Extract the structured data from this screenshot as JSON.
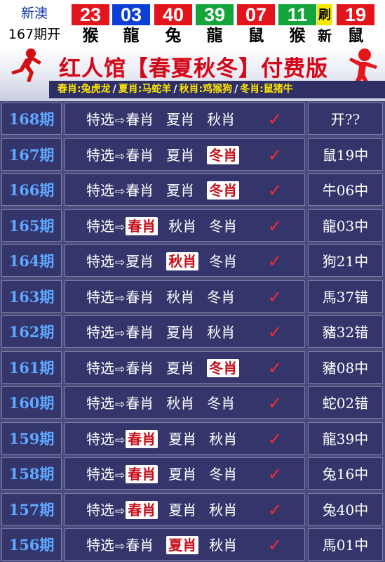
{
  "draw": {
    "label_line1": "新澳",
    "label_line2": "167期开",
    "balls": [
      {
        "num": "23",
        "zodiac": "猴",
        "color": "#e3141b"
      },
      {
        "num": "03",
        "zodiac": "龍",
        "color": "#0c3fd6"
      },
      {
        "num": "40",
        "zodiac": "兔",
        "color": "#e3141b"
      },
      {
        "num": "39",
        "zodiac": "龍",
        "color": "#14a53a"
      },
      {
        "num": "07",
        "zodiac": "鼠",
        "color": "#e3141b"
      },
      {
        "num": "11",
        "zodiac": "猴",
        "color": "#14a53a"
      },
      {
        "num": "刷",
        "zodiac": "新",
        "color": "#f6e800"
      },
      {
        "num": "19",
        "zodiac": "鼠",
        "color": "#e3141b"
      }
    ]
  },
  "banner": {
    "title": "红人馆【春夏秋冬】付费版",
    "seasons": [
      {
        "name": "春肖",
        "animals": "兔虎龙"
      },
      {
        "name": "夏肖",
        "animals": "马蛇羊"
      },
      {
        "name": "秋肖",
        "animals": "鸡猴狗"
      },
      {
        "name": "冬肖",
        "animals": "鼠猪牛"
      }
    ]
  },
  "table": {
    "prefix": "特选",
    "arrow": "⇨",
    "check": "✓",
    "rows": [
      {
        "period": "168期",
        "picks": [
          "春肖",
          "夏肖",
          "秋肖"
        ],
        "hit": -1,
        "result": "开??"
      },
      {
        "period": "167期",
        "picks": [
          "春肖",
          "夏肖",
          "冬肖"
        ],
        "hit": 2,
        "result": "鼠19中"
      },
      {
        "period": "166期",
        "picks": [
          "春肖",
          "夏肖",
          "冬肖"
        ],
        "hit": 2,
        "result": "牛06中"
      },
      {
        "period": "165期",
        "picks": [
          "春肖",
          "秋肖",
          "冬肖"
        ],
        "hit": 0,
        "result": "龍03中"
      },
      {
        "period": "164期",
        "picks": [
          "夏肖",
          "秋肖",
          "冬肖"
        ],
        "hit": 1,
        "result": "狗21中"
      },
      {
        "period": "163期",
        "picks": [
          "春肖",
          "秋肖",
          "冬肖"
        ],
        "hit": -1,
        "result": "馬37错"
      },
      {
        "period": "162期",
        "picks": [
          "春肖",
          "夏肖",
          "秋肖"
        ],
        "hit": -1,
        "result": "豬32错"
      },
      {
        "period": "161期",
        "picks": [
          "春肖",
          "夏肖",
          "冬肖"
        ],
        "hit": 2,
        "result": "豬08中"
      },
      {
        "period": "160期",
        "picks": [
          "春肖",
          "秋肖",
          "冬肖"
        ],
        "hit": -1,
        "result": "蛇02错"
      },
      {
        "period": "159期",
        "picks": [
          "春肖",
          "夏肖",
          "秋肖"
        ],
        "hit": 0,
        "result": "龍39中"
      },
      {
        "period": "158期",
        "picks": [
          "春肖",
          "夏肖",
          "冬肖"
        ],
        "hit": 0,
        "result": "兔16中"
      },
      {
        "period": "157期",
        "picks": [
          "春肖",
          "夏肖",
          "秋肖"
        ],
        "hit": 0,
        "result": "兔40中"
      },
      {
        "period": "156期",
        "picks": [
          "春肖",
          "夏肖",
          "秋肖"
        ],
        "hit": 1,
        "result": "馬01中"
      }
    ]
  }
}
